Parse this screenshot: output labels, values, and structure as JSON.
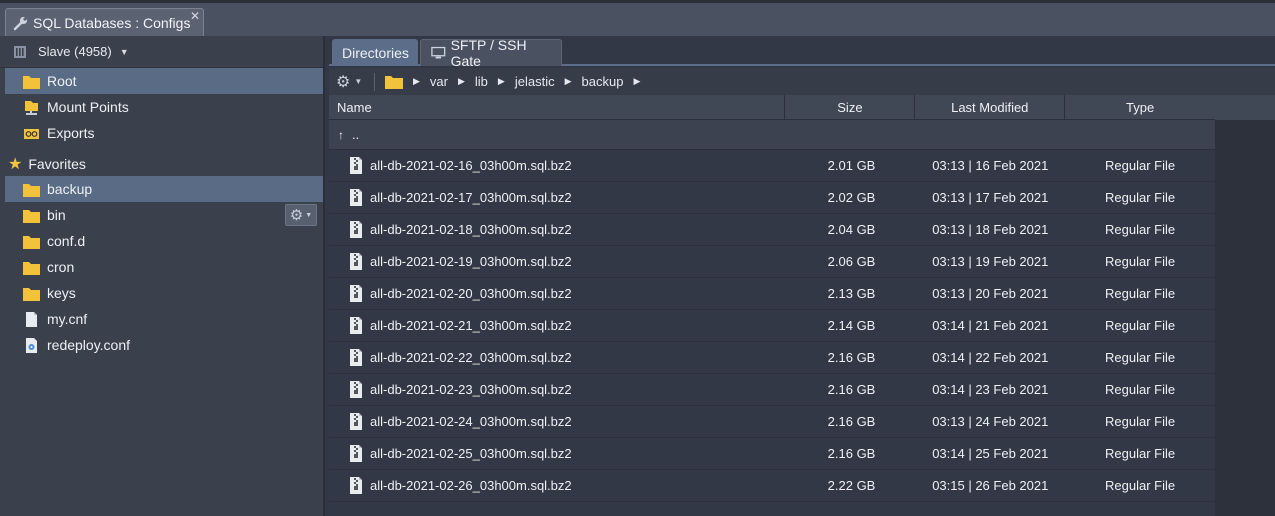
{
  "window_tab": {
    "title": "SQL Databases : Configs",
    "close": "✕"
  },
  "left_panel": {
    "node_selector": "Slave (4958)",
    "roots": [
      {
        "label": "Root",
        "icon": "folder-icon"
      },
      {
        "label": "Mount Points",
        "icon": "mount-icon"
      },
      {
        "label": "Exports",
        "icon": "exports-icon"
      }
    ],
    "favorites_label": "Favorites",
    "favorites": [
      {
        "label": "backup",
        "icon": "folder-icon"
      },
      {
        "label": "bin",
        "icon": "folder-icon"
      },
      {
        "label": "conf.d",
        "icon": "folder-icon"
      },
      {
        "label": "cron",
        "icon": "folder-icon"
      },
      {
        "label": "keys",
        "icon": "folder-icon"
      },
      {
        "label": "my.cnf",
        "icon": "file-icon"
      },
      {
        "label": "redeploy.conf",
        "icon": "config-file-icon"
      }
    ]
  },
  "tabs": {
    "directories": "Directories",
    "sftp": "SFTP / SSH Gate"
  },
  "breadcrumb": [
    "var",
    "lib",
    "jelastic",
    "backup"
  ],
  "columns": {
    "name": "Name",
    "size": "Size",
    "modified": "Last Modified",
    "type": "Type"
  },
  "up_label": "..",
  "files": [
    {
      "name": "all-db-2021-02-16_03h00m.sql.bz2",
      "size": "2.01 GB",
      "modified": "03:13 | 16 Feb 2021",
      "type": "Regular File"
    },
    {
      "name": "all-db-2021-02-17_03h00m.sql.bz2",
      "size": "2.02 GB",
      "modified": "03:13 | 17 Feb 2021",
      "type": "Regular File"
    },
    {
      "name": "all-db-2021-02-18_03h00m.sql.bz2",
      "size": "2.04 GB",
      "modified": "03:13 | 18 Feb 2021",
      "type": "Regular File"
    },
    {
      "name": "all-db-2021-02-19_03h00m.sql.bz2",
      "size": "2.06 GB",
      "modified": "03:13 | 19 Feb 2021",
      "type": "Regular File"
    },
    {
      "name": "all-db-2021-02-20_03h00m.sql.bz2",
      "size": "2.13 GB",
      "modified": "03:13 | 20 Feb 2021",
      "type": "Regular File"
    },
    {
      "name": "all-db-2021-02-21_03h00m.sql.bz2",
      "size": "2.14 GB",
      "modified": "03:14 | 21 Feb 2021",
      "type": "Regular File"
    },
    {
      "name": "all-db-2021-02-22_03h00m.sql.bz2",
      "size": "2.16 GB",
      "modified": "03:14 | 22 Feb 2021",
      "type": "Regular File"
    },
    {
      "name": "all-db-2021-02-23_03h00m.sql.bz2",
      "size": "2.16 GB",
      "modified": "03:14 | 23 Feb 2021",
      "type": "Regular File"
    },
    {
      "name": "all-db-2021-02-24_03h00m.sql.bz2",
      "size": "2.16 GB",
      "modified": "03:13 | 24 Feb 2021",
      "type": "Regular File"
    },
    {
      "name": "all-db-2021-02-25_03h00m.sql.bz2",
      "size": "2.16 GB",
      "modified": "03:14 | 25 Feb 2021",
      "type": "Regular File"
    },
    {
      "name": "all-db-2021-02-26_03h00m.sql.bz2",
      "size": "2.22 GB",
      "modified": "03:15 | 26 Feb 2021",
      "type": "Regular File"
    }
  ],
  "colors": {
    "selection": "#5a6b86",
    "active_tab": "#5c6d89",
    "folder": "#f2c23a"
  }
}
